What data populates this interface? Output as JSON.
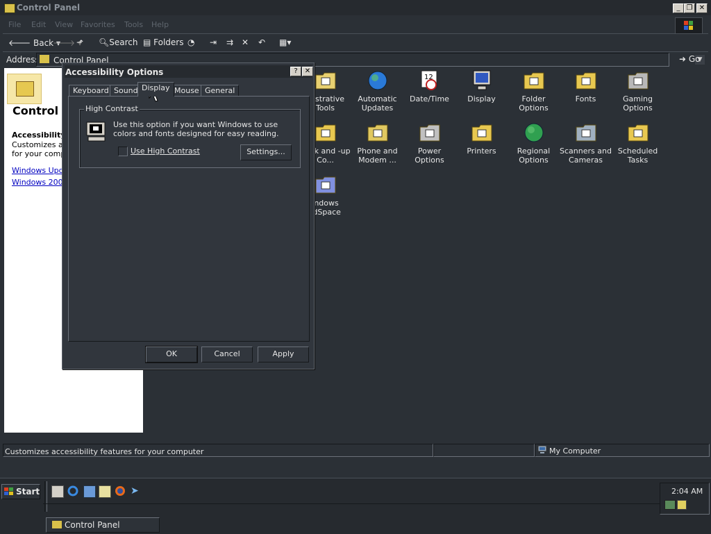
{
  "window": {
    "title": "Control Panel"
  },
  "menu": [
    "File",
    "Edit",
    "View",
    "Favorites",
    "Tools",
    "Help"
  ],
  "toolbar": {
    "back": "Back",
    "search": "Search",
    "folders": "Folders"
  },
  "address": {
    "label": "Address",
    "value": "Control Panel",
    "go": "Go"
  },
  "left_pane": {
    "title": "Control P",
    "heading": "Accessibility",
    "desc_line1": "Customizes acc",
    "desc_line2": "for your compu",
    "links": [
      "Windows Upda",
      "Windows 2000"
    ]
  },
  "items": [
    {
      "label": "inistrative Tools",
      "icon": "administrative-tools-icon"
    },
    {
      "label": "Automatic Updates",
      "icon": "automatic-updates-icon"
    },
    {
      "label": "Date/Time",
      "icon": "calendar-clock-icon"
    },
    {
      "label": "Display",
      "icon": "display-monitor-icon"
    },
    {
      "label": "Folder Options",
      "icon": "folder-options-icon"
    },
    {
      "label": "Fonts",
      "icon": "fonts-folder-icon"
    },
    {
      "label": "Gaming Options",
      "icon": "joystick-icon"
    },
    {
      "label": "work and -up Co...",
      "icon": "network-connections-icon"
    },
    {
      "label": "Phone and Modem ...",
      "icon": "telephone-icon"
    },
    {
      "label": "Power Options",
      "icon": "power-plug-icon"
    },
    {
      "label": "Printers",
      "icon": "printer-folder-icon"
    },
    {
      "label": "Regional Options",
      "icon": "globe-icon"
    },
    {
      "label": "Scanners and Cameras",
      "icon": "scanner-camera-icon"
    },
    {
      "label": "Scheduled Tasks",
      "icon": "scheduled-tasks-icon"
    },
    {
      "label": "indows rdSpace",
      "icon": "cardspace-icon"
    }
  ],
  "status": {
    "text": "Customizes accessibility features for your computer",
    "zone": "My Computer"
  },
  "dialog": {
    "title": "Accessibility Options",
    "help": "?",
    "close": "✕",
    "tabs": [
      "Keyboard",
      "Sound",
      "Display",
      "Mouse",
      "General"
    ],
    "active_tab": "Display",
    "group_label": "High Contrast",
    "description": "Use this option if you want Windows to use colors and fonts designed for easy reading.",
    "checkbox_label": "Use High Contrast",
    "checkbox_checked": false,
    "settings": "Settings...",
    "ok": "OK",
    "cancel": "Cancel",
    "apply": "Apply"
  },
  "taskbar": {
    "start": "Start",
    "task": "Control Panel",
    "clock": "2:04 AM"
  }
}
